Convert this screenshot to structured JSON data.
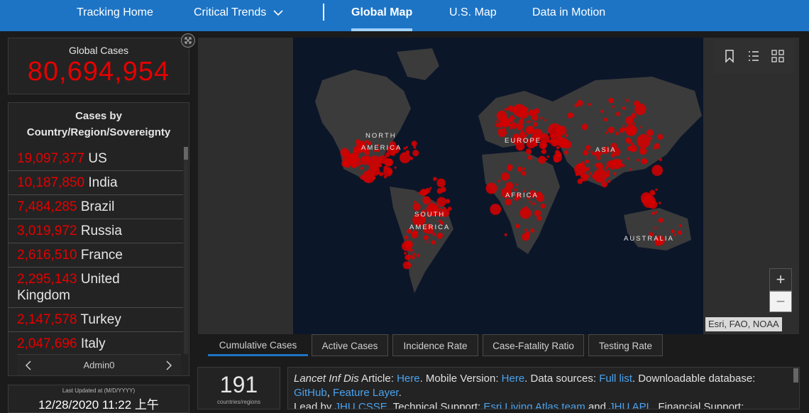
{
  "nav": {
    "items": [
      {
        "label": "Tracking Home"
      },
      {
        "label": "Critical Trends"
      },
      {
        "label": "Global Map"
      },
      {
        "label": "U.S. Map"
      },
      {
        "label": "Data in Motion"
      }
    ],
    "active": "Global Map"
  },
  "global": {
    "label": "Global Cases",
    "value": "80,694,954"
  },
  "countries": {
    "title": "Cases by Country/Region/Sovereignty",
    "rows": [
      {
        "value": "19,097,377",
        "name": "US"
      },
      {
        "value": "10,187,850",
        "name": "India"
      },
      {
        "value": "7,484,285",
        "name": "Brazil"
      },
      {
        "value": "3,019,972",
        "name": "Russia"
      },
      {
        "value": "2,616,510",
        "name": "France"
      },
      {
        "value": "2,295,143",
        "name": "United Kingdom"
      },
      {
        "value": "2,147,578",
        "name": "Turkey"
      },
      {
        "value": "2,047,696",
        "name": "Italy"
      }
    ],
    "pager_label": "Admin0"
  },
  "last_updated": {
    "label": "Last Updated at (M/D/YYYY)",
    "value": "12/28/2020 11:22 上午"
  },
  "map": {
    "continents": [
      "NORTH",
      "AMERICA",
      "EUROPE",
      "ASIA",
      "AFRICA",
      "SOUTH",
      "AMERICA",
      "AUSTRALIA"
    ],
    "attribution": "Esri, FAO, NOAA",
    "zoom_in": "+",
    "zoom_out": "−",
    "colors": {
      "land": "#3a3a3a",
      "ocean": "#0c1629",
      "case": "#d40000"
    }
  },
  "tabs": [
    {
      "label": "Cumulative Cases"
    },
    {
      "label": "Active Cases"
    },
    {
      "label": "Incidence Rate"
    },
    {
      "label": "Case-Fatality Ratio"
    },
    {
      "label": "Testing Rate"
    }
  ],
  "count": {
    "value": "191",
    "label": "countries/regions"
  },
  "info": {
    "article_label": "Lancet Inf Dis",
    "article_text": " Article: ",
    "here1": "Here",
    "mobile_text": ". Mobile Version: ",
    "here2": "Here",
    "sources_text": ". Data sources: ",
    "full_list": "Full list",
    "download_text": ". Downloadable database: ",
    "github": "GitHub",
    "comma": ", ",
    "feature_layer": "Feature Layer",
    "period": ".",
    "lead_text": "Lead by ",
    "jhu_csse": "JHU CSSE",
    "tech_text": ". Technical Support: ",
    "esri": "Esri Living Atlas team",
    "and_text": " and ",
    "jhu_apl": "JHU APL",
    "fin_text": ". Financial Support:"
  }
}
